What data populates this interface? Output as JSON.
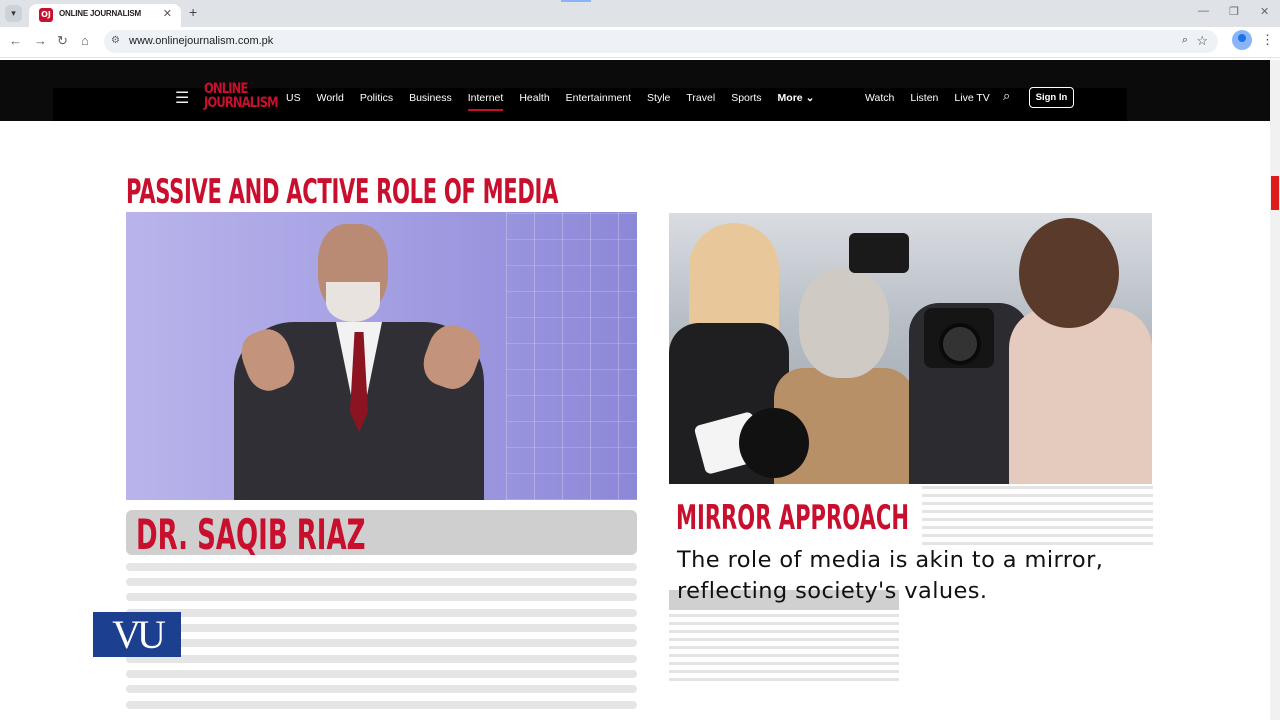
{
  "browser": {
    "tab_title": "ONLINE JOURNALISM",
    "favicon_text": "OJ",
    "url": "www.onlinejournalism.com.pk"
  },
  "site": {
    "logo_line1": "ONLINE",
    "logo_line2": "JOURNALISM",
    "nav_links": [
      "US",
      "World",
      "Politics",
      "Business",
      "Internet",
      "Health",
      "Entertainment",
      "Style",
      "Travel",
      "Sports"
    ],
    "nav_active": "Internet",
    "more_label": "More",
    "right_links": [
      "Watch",
      "Listen",
      "Live TV"
    ],
    "signin_label": "Sign In",
    "accent_color": "#c8102e"
  },
  "content": {
    "headline": "PASSIVE AND ACTIVE ROLE OF MEDIA",
    "presenter_name": "DR. SAQIB RIAZ",
    "watermark": "VU",
    "section_title": "MIRROR APPROACH",
    "section_desc_line1": "The role of media is akin to a mirror,",
    "section_desc_line2": "reflecting society's values."
  }
}
